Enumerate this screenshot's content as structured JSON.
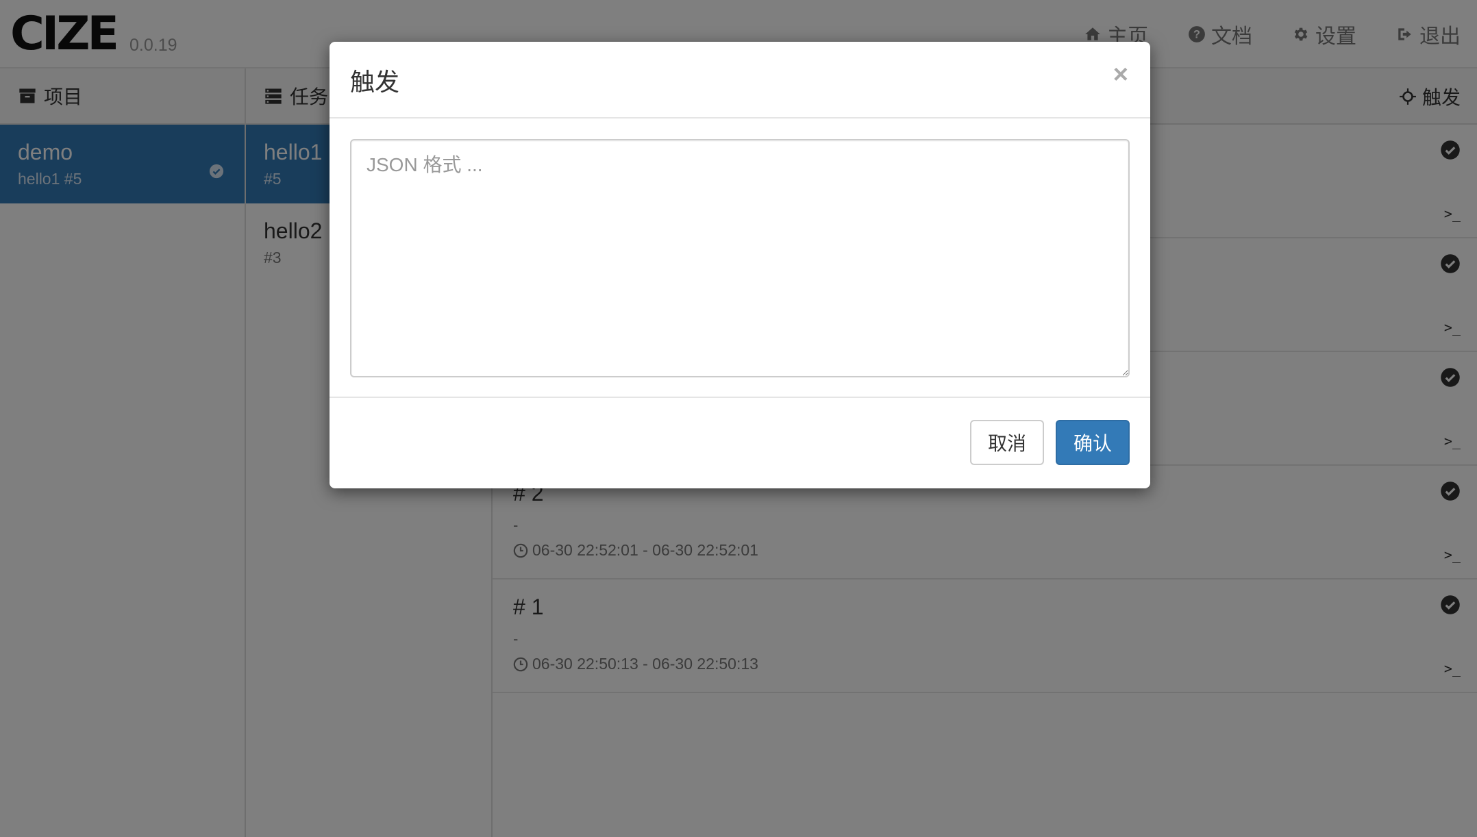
{
  "header": {
    "logo": "CIZE",
    "version": "0.0.19",
    "nav": [
      {
        "label": "主页",
        "icon": "home-icon"
      },
      {
        "label": "文档",
        "icon": "question-circle-icon"
      },
      {
        "label": "设置",
        "icon": "gear-icon"
      },
      {
        "label": "退出",
        "icon": "sign-out-icon"
      }
    ]
  },
  "projects": {
    "heading": "项目",
    "items": [
      {
        "name": "demo",
        "sub": "hello1 #5",
        "active": true
      }
    ]
  },
  "tasks": {
    "heading": "任务",
    "items": [
      {
        "name": "hello1",
        "sub": "#5",
        "active": true
      },
      {
        "name": "hello2",
        "sub": "#3",
        "active": false
      }
    ]
  },
  "records": {
    "trigger_label": "触发",
    "items": [
      {
        "title": "# 2",
        "desc": "-",
        "time": "06-30 22:52:01 - 06-30 22:52:01",
        "term": ">_"
      },
      {
        "title": "# 1",
        "desc": "-",
        "time": "06-30 22:50:13 - 06-30 22:50:13",
        "term": ">_"
      }
    ],
    "hidden_terms": [
      ">_",
      ">_",
      ">_"
    ]
  },
  "modal": {
    "title": "触发",
    "close": "×",
    "textarea_placeholder": "JSON 格式 ...",
    "textarea_value": "",
    "cancel_label": "取消",
    "confirm_label": "确认"
  },
  "colors": {
    "accent": "#337ab7",
    "backdrop": "rgba(0,0,0,0.5)"
  }
}
